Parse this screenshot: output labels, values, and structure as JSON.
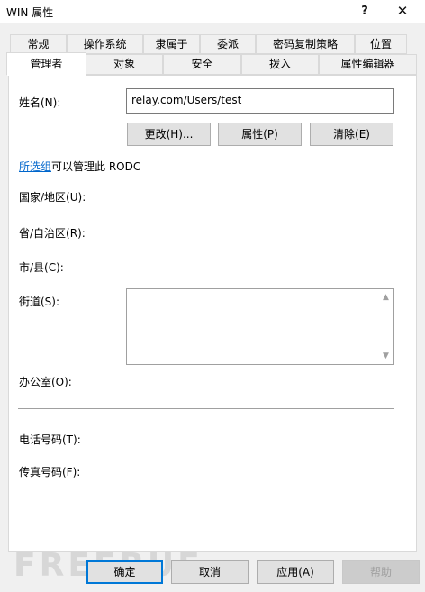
{
  "window": {
    "title": "WIN 属性",
    "help_glyph": "?",
    "close_glyph": "✕"
  },
  "tabs": {
    "row1": [
      "常规",
      "操作系统",
      "隶属于",
      "委派",
      "密码复制策略",
      "位置"
    ],
    "row2": [
      "管理者",
      "对象",
      "安全",
      "拨入",
      "属性编辑器"
    ],
    "active": "管理者"
  },
  "manager": {
    "name_label": "姓名(N):",
    "name_value": "relay.com/Users/test",
    "change_button": "更改(H)...",
    "properties_button": "属性(P)",
    "clear_button": "清除(E)",
    "group_link": "所选组",
    "group_text": "可以管理此 RODC",
    "country_label": "国家/地区(U):",
    "state_label": "省/自治区(R):",
    "city_label": "市/县(C):",
    "street_label": "街道(S):",
    "street_value": "",
    "office_label": "办公室(O):",
    "phone_label": "电话号码(T):",
    "fax_label": "传真号码(F):"
  },
  "footer": {
    "ok": "确定",
    "cancel": "取消",
    "apply": "应用(A)",
    "help": "帮助"
  },
  "watermark": "FREEBUF",
  "icons": {
    "scroll_up": "scroll-up-arrow-icon",
    "scroll_down": "scroll-down-arrow-icon"
  },
  "colors": {
    "accent": "#0078d7",
    "link": "#0066cc"
  }
}
